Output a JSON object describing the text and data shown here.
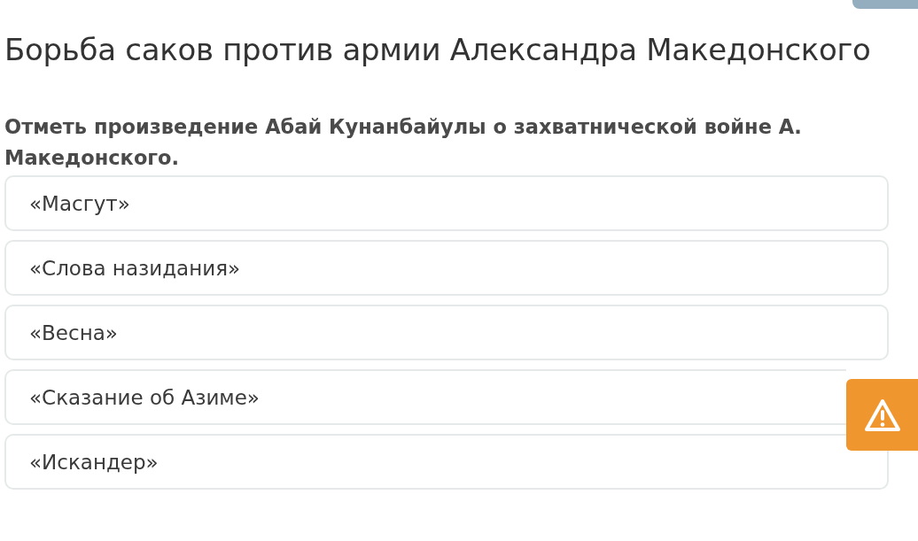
{
  "title": "Борьба саков против армии Александра Македонского",
  "question": "Отметь произведение Абай Кунанбайулы о захватнической войне А. Македонского.",
  "options": [
    {
      "label": "«Масгут»"
    },
    {
      "label": "«Слова назидания»"
    },
    {
      "label": "«Весна»"
    },
    {
      "label": "«Сказание об Азиме»"
    },
    {
      "label": "«Искандер»"
    }
  ]
}
